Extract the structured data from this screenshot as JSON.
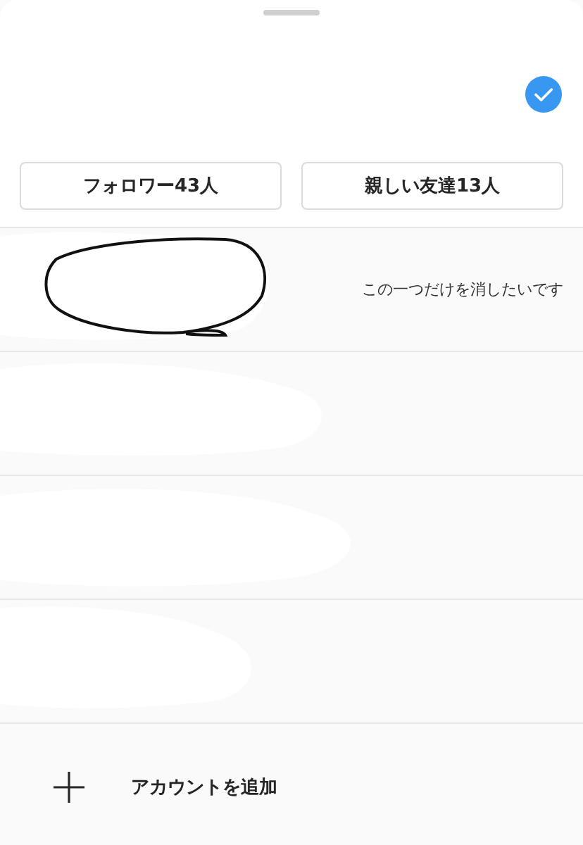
{
  "audience_buttons": [
    {
      "label": "フォロワー43人"
    },
    {
      "label": "親しい友達13人"
    }
  ],
  "accounts": [
    {
      "kind": "circled",
      "note": "この一つだけを消したいです"
    },
    {
      "kind": "erased"
    },
    {
      "kind": "erased"
    },
    {
      "kind": "erased"
    }
  ],
  "add_account": {
    "label": "アカウントを追加"
  }
}
